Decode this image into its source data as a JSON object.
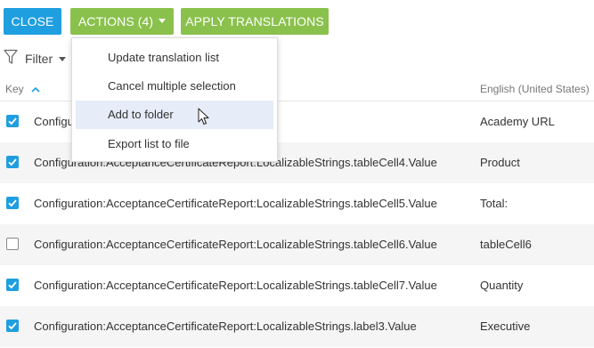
{
  "toolbar": {
    "close_label": "CLOSE",
    "actions_label": "ACTIONS (4)",
    "apply_label": "APPLY TRANSLATIONS",
    "close_color": "#1f9ee0",
    "accent_color": "#8ac14d"
  },
  "filter": {
    "label": "Filter",
    "icon": "filter-icon"
  },
  "columns": {
    "key": "Key",
    "english": "English (United States)"
  },
  "rows": [
    {
      "checked": true,
      "key": "Configuration:AcceptanceCertificateReport:LocalizableStrings.tableCell3.Value",
      "visible_key": "Configuration:",
      "value": "Academy URL"
    },
    {
      "checked": true,
      "key": "Configuration:AcceptanceCertificateReport:LocalizableStrings.tableCell4.Value",
      "value": "Product"
    },
    {
      "checked": true,
      "key": "Configuration:AcceptanceCertificateReport:LocalizableStrings.tableCell5.Value",
      "value": "Total:"
    },
    {
      "checked": false,
      "key": "Configuration:AcceptanceCertificateReport:LocalizableStrings.tableCell6.Value",
      "value": "tableCell6"
    },
    {
      "checked": true,
      "key": "Configuration:AcceptanceCertificateReport:LocalizableStrings.tableCell7.Value",
      "value": "Quantity"
    },
    {
      "checked": true,
      "key": "Configuration:AcceptanceCertificateReport:LocalizableStrings.label3.Value",
      "value": "Executive"
    }
  ],
  "actions_menu": {
    "items": [
      "Update translation list",
      "Cancel multiple selection",
      "Add to folder",
      "Export list to file"
    ],
    "hovered_item": "Add to folder"
  }
}
